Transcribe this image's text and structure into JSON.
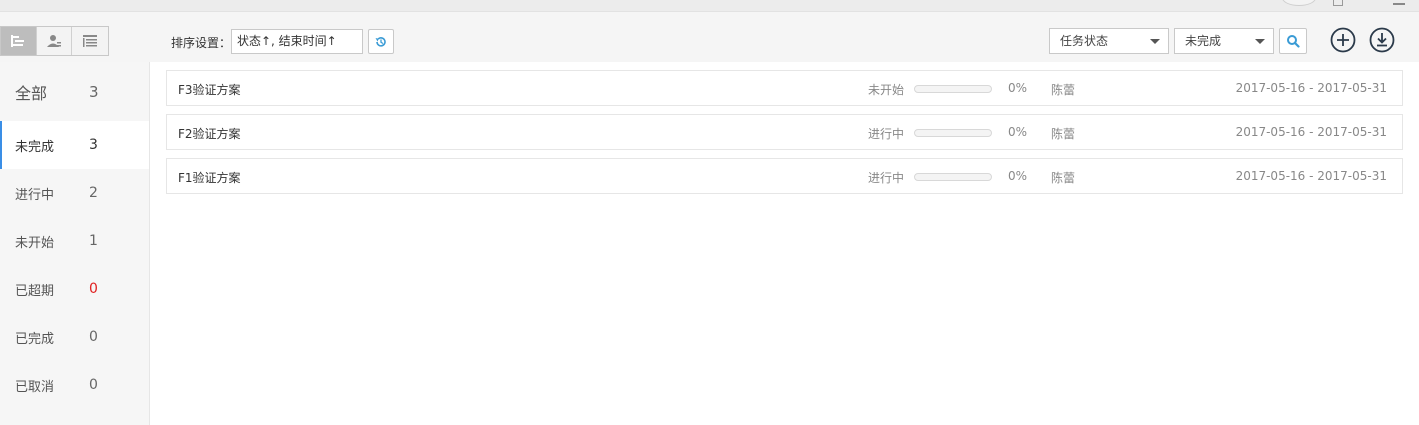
{
  "toolbar": {
    "sort_label": "排序设置：",
    "sort_value": "状态↑, 结束时间↑",
    "status_select": "任务状态",
    "completion_select": "未完成",
    "view_icons": [
      "tree-view-icon",
      "person-view-icon",
      "list-view-icon"
    ]
  },
  "sidebar": {
    "items": [
      {
        "label": "全部",
        "count": "3"
      },
      {
        "label": "未完成",
        "count": "3",
        "active": true
      },
      {
        "label": "进行中",
        "count": "2"
      },
      {
        "label": "未开始",
        "count": "1"
      },
      {
        "label": "已超期",
        "count": "0",
        "alert": true
      },
      {
        "label": "已完成",
        "count": "0"
      },
      {
        "label": "已取消",
        "count": "0"
      }
    ]
  },
  "tasks": [
    {
      "name": "F3验证方案",
      "status": "未开始",
      "progress_pct": 0,
      "progress_label": "0%",
      "owner": "陈蕾",
      "dates": "2017-05-16 -   2017-05-31"
    },
    {
      "name": "F2验证方案",
      "status": "进行中",
      "progress_pct": 0,
      "progress_label": "0%",
      "owner": "陈蕾",
      "dates": "2017-05-16 -   2017-05-31"
    },
    {
      "name": "F1验证方案",
      "status": "进行中",
      "progress_pct": 0,
      "progress_label": "0%",
      "owner": "陈蕾",
      "dates": "2017-05-16 -   2017-05-31"
    }
  ],
  "colors": {
    "accent": "#3a8ee6",
    "alert": "#e02020",
    "search_icon": "#3a9bd5"
  }
}
